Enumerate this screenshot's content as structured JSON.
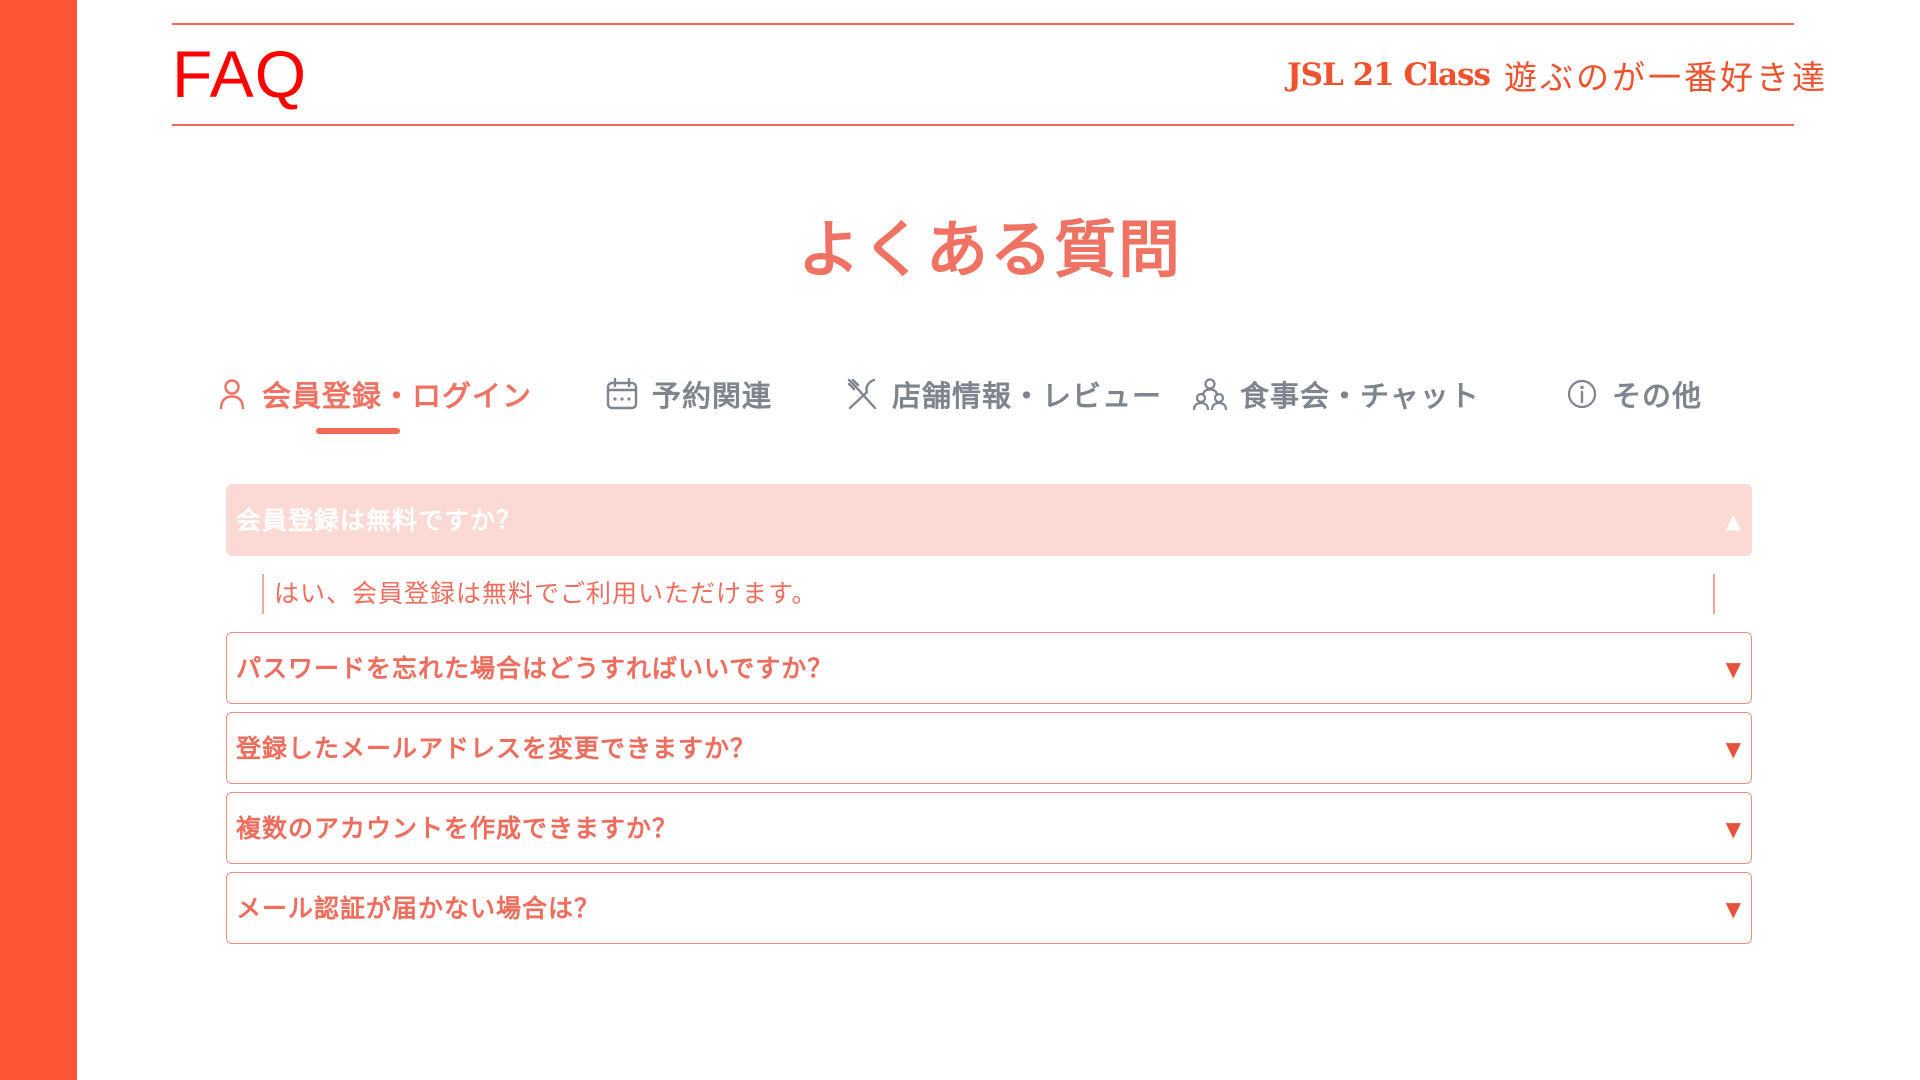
{
  "slide": {
    "title": "FAQ",
    "brand_name": "JSL 21 Class",
    "brand_tagline": "遊ぶのが一番好き達"
  },
  "faq": {
    "heading": "よくある質問",
    "tabs": [
      {
        "label": "会員登録・ログイン",
        "icon": "user-icon",
        "active": true
      },
      {
        "label": "予約関連",
        "icon": "calendar-icon",
        "active": false
      },
      {
        "label": "店舗情報・レビュー",
        "icon": "utensils-icon",
        "active": false
      },
      {
        "label": "食事会・チャット",
        "icon": "group-icon",
        "active": false
      },
      {
        "label": "その他",
        "icon": "info-icon",
        "active": false
      }
    ],
    "items": [
      {
        "question": "会員登録は無料ですか？",
        "answer": "はい、会員登録は無料でご利用いただけます。",
        "expanded": true,
        "arrow": "▲"
      },
      {
        "question": "パスワードを忘れた場合はどうすればいいですか？",
        "expanded": false,
        "arrow": "▼"
      },
      {
        "question": "登録したメールアドレスを変更できますか？",
        "expanded": false,
        "arrow": "▼"
      },
      {
        "question": "複数のアカウントを作成できますか？",
        "expanded": false,
        "arrow": "▼"
      },
      {
        "question": "メール認証が届かない場合は？",
        "expanded": false,
        "arrow": "▼"
      }
    ]
  },
  "colors": {
    "accent": "#ff5537",
    "brand_text": "#f0522e",
    "heading": "#ef7262",
    "tab_inactive": "#7e858f",
    "open_item_bg": "#fbd9d4",
    "item_border": "#f08f80"
  }
}
